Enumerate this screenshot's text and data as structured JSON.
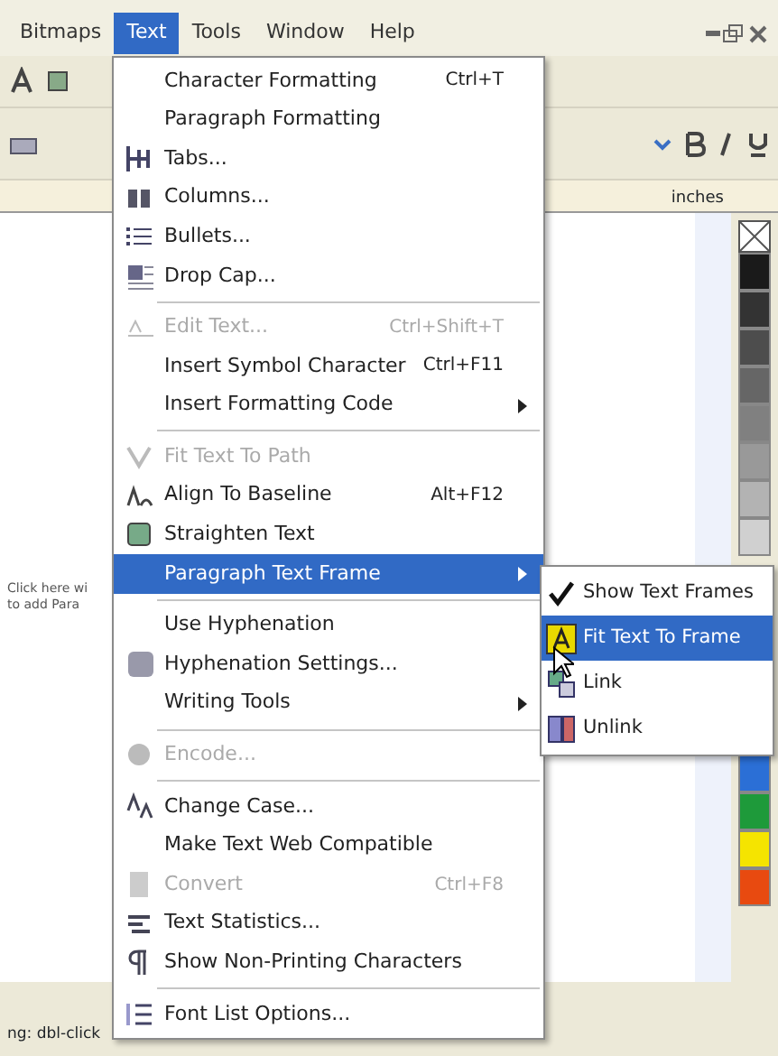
{
  "menubar": [
    {
      "label": "Bitmaps",
      "selected": false
    },
    {
      "label": "Text",
      "selected": true
    },
    {
      "label": "Tools",
      "selected": false
    },
    {
      "label": "Window",
      "selected": false
    },
    {
      "label": "Help",
      "selected": false
    }
  ],
  "toolbar": {
    "ruler_unit": "inches"
  },
  "canvas": {
    "hint_lines": [
      "Click here wi",
      "to add Para"
    ]
  },
  "status_bar": {
    "text": "ng: dbl-click"
  },
  "palette": [
    {
      "color": "#1a1a1a"
    },
    {
      "color": "#333333"
    },
    {
      "color": "#4d4d4d"
    },
    {
      "color": "#666666"
    },
    {
      "color": "#808080"
    },
    {
      "color": "#999999"
    },
    {
      "color": "#b3b3b3"
    },
    {
      "color": "#d0d0d0"
    },
    {
      "color": "#2b6fd6"
    },
    {
      "color": "#1e9a3a"
    },
    {
      "color": "#f5e400"
    },
    {
      "color": "#e84a10"
    }
  ],
  "menu": [
    {
      "kind": "item",
      "label": "Character Formatting",
      "shortcut": "Ctrl+T",
      "disabled": false,
      "submenu": false,
      "selected": false
    },
    {
      "kind": "item",
      "label": "Paragraph Formatting",
      "disabled": false,
      "submenu": false,
      "selected": false
    },
    {
      "kind": "item",
      "label": "Tabs...",
      "disabled": false,
      "submenu": false,
      "selected": false
    },
    {
      "kind": "item",
      "label": "Columns...",
      "disabled": false,
      "submenu": false,
      "selected": false
    },
    {
      "kind": "item",
      "label": "Bullets...",
      "disabled": false,
      "submenu": false,
      "selected": false
    },
    {
      "kind": "item",
      "label": "Drop Cap...",
      "disabled": false,
      "submenu": false,
      "selected": false
    },
    {
      "kind": "separator"
    },
    {
      "kind": "item",
      "label": "Edit Text...",
      "shortcut": "Ctrl+Shift+T",
      "disabled": true,
      "submenu": false,
      "selected": false
    },
    {
      "kind": "item",
      "label": "Insert Symbol Character",
      "shortcut": "Ctrl+F11",
      "disabled": false,
      "submenu": false,
      "selected": false
    },
    {
      "kind": "item",
      "label": "Insert Formatting Code",
      "disabled": false,
      "submenu": true,
      "selected": false
    },
    {
      "kind": "separator"
    },
    {
      "kind": "item",
      "label": "Fit Text To Path",
      "disabled": true,
      "submenu": false,
      "selected": false
    },
    {
      "kind": "item",
      "label": "Align To Baseline",
      "shortcut": "Alt+F12",
      "disabled": false,
      "submenu": false,
      "selected": false
    },
    {
      "kind": "item",
      "label": "Straighten Text",
      "disabled": false,
      "submenu": false,
      "selected": false
    },
    {
      "kind": "item",
      "label": "Paragraph Text Frame",
      "disabled": false,
      "submenu": true,
      "selected": true
    },
    {
      "kind": "separator"
    },
    {
      "kind": "item",
      "label": "Use Hyphenation",
      "disabled": false,
      "submenu": false,
      "selected": false
    },
    {
      "kind": "item",
      "label": "Hyphenation Settings...",
      "disabled": false,
      "submenu": false,
      "selected": false
    },
    {
      "kind": "item",
      "label": "Writing Tools",
      "disabled": false,
      "submenu": true,
      "selected": false
    },
    {
      "kind": "separator"
    },
    {
      "kind": "item",
      "label": "Encode...",
      "disabled": true,
      "submenu": false,
      "selected": false
    },
    {
      "kind": "separator"
    },
    {
      "kind": "item",
      "label": "Change Case...",
      "disabled": false,
      "submenu": false,
      "selected": false
    },
    {
      "kind": "item",
      "label": "Make Text Web Compatible",
      "disabled": false,
      "submenu": false,
      "selected": false
    },
    {
      "kind": "item",
      "label": "Convert",
      "shortcut": "Ctrl+F8",
      "disabled": true,
      "submenu": false,
      "selected": false
    },
    {
      "kind": "item",
      "label": "Text Statistics...",
      "disabled": false,
      "submenu": false,
      "selected": false
    },
    {
      "kind": "item",
      "label": "Show Non-Printing Characters",
      "disabled": false,
      "submenu": false,
      "selected": false
    },
    {
      "kind": "separator"
    },
    {
      "kind": "item",
      "label": "Font List Options...",
      "disabled": false,
      "submenu": false,
      "selected": false
    }
  ],
  "submenu": [
    {
      "label": "Show Text Frames",
      "checked": true,
      "selected": false
    },
    {
      "label": "Fit Text To Frame",
      "checked": false,
      "selected": true
    },
    {
      "label": "Link",
      "checked": false,
      "selected": false
    },
    {
      "label": "Unlink",
      "checked": false,
      "selected": false
    }
  ]
}
